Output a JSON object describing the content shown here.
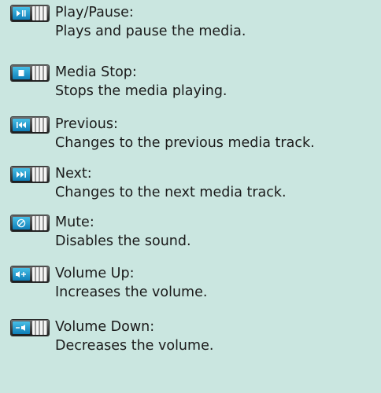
{
  "items": [
    {
      "icon": "play-pause-icon",
      "title": "Play/Pause:",
      "description": "Plays and pause the media."
    },
    {
      "icon": "stop-icon",
      "title": "Media Stop:",
      "description": "Stops the media playing."
    },
    {
      "icon": "previous-track-icon",
      "title": "Previous:",
      "description": "Changes to the previous media track."
    },
    {
      "icon": "next-track-icon",
      "title": "Next:",
      "description": "Changes to the next media track."
    },
    {
      "icon": "mute-icon",
      "title": "Mute:",
      "description": "Disables the sound."
    },
    {
      "icon": "volume-up-icon",
      "title": "Volume Up:",
      "description": "Increases the volume."
    },
    {
      "icon": "volume-down-icon",
      "title": "Volume Down:",
      "description": "Decreases the volume."
    }
  ]
}
